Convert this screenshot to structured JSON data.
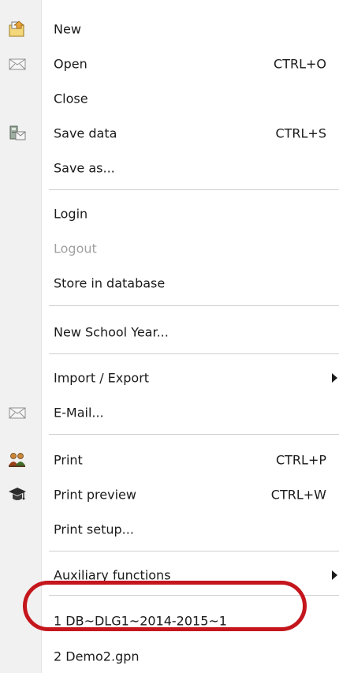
{
  "menu": {
    "items": [
      {
        "label": "New",
        "icon": "new-document-icon"
      },
      {
        "label": "Open",
        "shortcut": "CTRL+O",
        "icon": "envelope-icon"
      },
      {
        "label": "Close"
      },
      {
        "label": "Save data",
        "shortcut": "CTRL+S",
        "icon": "save-data-icon"
      },
      {
        "label": "Save as..."
      },
      {
        "label": "Login"
      },
      {
        "label": "Logout",
        "disabled": true
      },
      {
        "label": "Store in database"
      },
      {
        "label": "New School Year..."
      },
      {
        "label": "Import / Export",
        "submenu": true
      },
      {
        "label": "E-Mail...",
        "icon": "envelope-icon"
      },
      {
        "label": "Print",
        "shortcut": "CTRL+P",
        "icon": "people-icon"
      },
      {
        "label": "Print preview",
        "shortcut": "CTRL+W",
        "icon": "graduation-cap-icon"
      },
      {
        "label": "Print setup..."
      },
      {
        "label": "Auxiliary functions",
        "submenu": true
      },
      {
        "label": "1 DB~DLG1~2014-2015~1",
        "highlighted": true
      },
      {
        "label": "2 Demo2.gpn"
      }
    ]
  },
  "colors": {
    "gutter": "#f1f1f1",
    "highlight_oval": "#c4161c",
    "disabled_text": "#a0a0a0"
  }
}
